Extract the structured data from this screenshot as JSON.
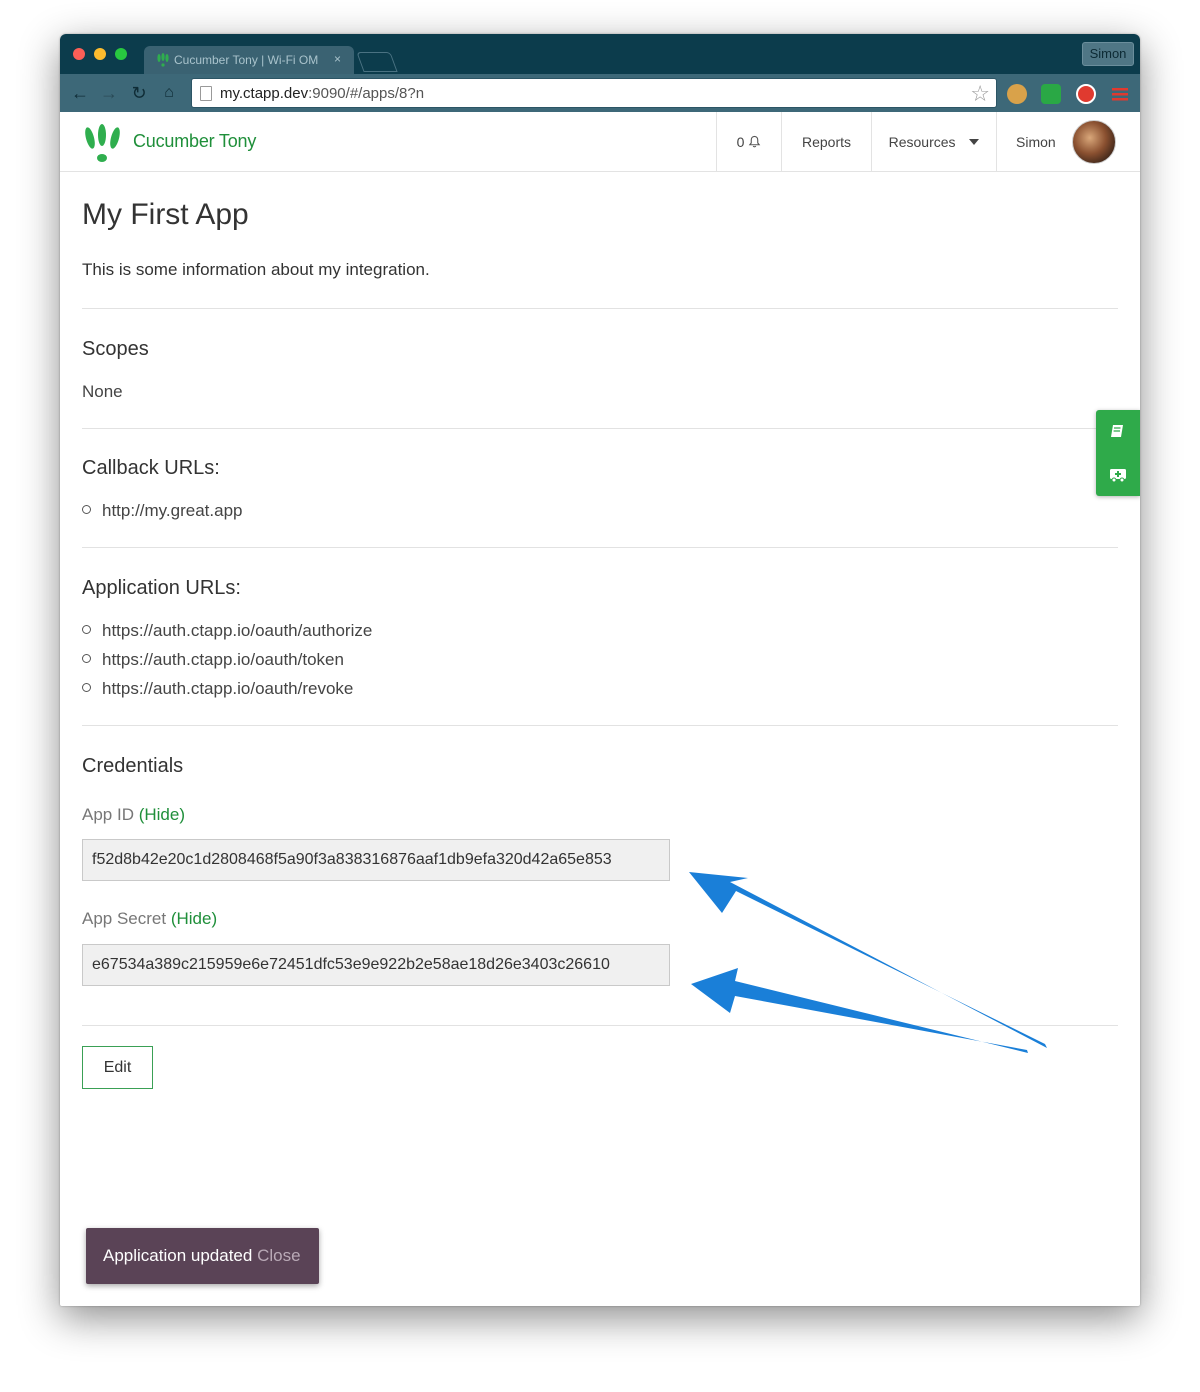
{
  "browser": {
    "tab_title": "Cucumber Tony | Wi-Fi OM",
    "tab_close": "×",
    "profile_name": "Simon",
    "url_host": "my.ctapp.dev",
    "url_rest": ":9090/#/apps/8?n"
  },
  "navbar": {
    "brand": "Cucumber Tony",
    "notifications": "0",
    "reports": "Reports",
    "resources": "Resources",
    "user": "Simon"
  },
  "app": {
    "title": "My First App",
    "description": "This is some information about my integration.",
    "scopes_heading": "Scopes",
    "scopes_value": "None",
    "callback_heading": "Callback URLs:",
    "callback_urls": [
      "http://my.great.app"
    ],
    "app_urls_heading": "Application URLs:",
    "app_urls": [
      "https://auth.ctapp.io/oauth/authorize",
      "https://auth.ctapp.io/oauth/token",
      "https://auth.ctapp.io/oauth/revoke"
    ],
    "credentials_heading": "Credentials",
    "app_id_label": "App ID",
    "app_secret_label": "App Secret",
    "hide_link": "(Hide)",
    "app_id_value": "f52d8b42e20c1d2808468f5a90f3a838316876aaf1db9efa320d42a65e853",
    "app_secret_value": "e67534a389c215959e6e72451dfc53e9e922b2e58ae18d26e3403c26610",
    "edit_button": "Edit"
  },
  "toast": {
    "message": "Application updated",
    "close": "Close"
  },
  "colors": {
    "brand_green": "#1f8f3a",
    "browser_chrome": "#0c3c4c",
    "toast_bg": "#5a4356",
    "arrow_blue": "#1a7fd8"
  }
}
